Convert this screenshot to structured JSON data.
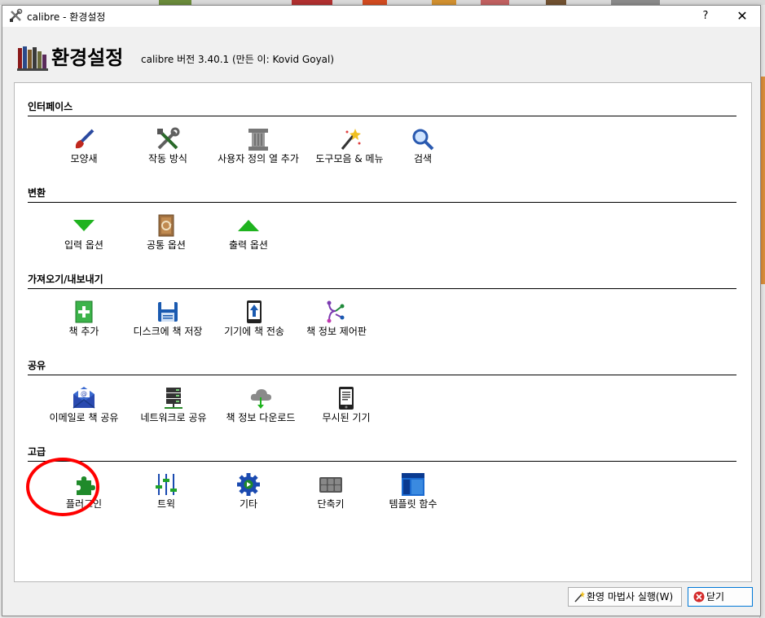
{
  "window": {
    "title": "calibre - 환경설정",
    "help_label": "?",
    "close_label": "✕"
  },
  "header": {
    "title": "환경설정",
    "version_info": "calibre 버전 3.40.1 (만든 이: Kovid Goyal)"
  },
  "sections": [
    {
      "title": "인터페이스",
      "items": [
        {
          "label": "모양새",
          "icon": "paintbrush-icon"
        },
        {
          "label": "작동 방식",
          "icon": "tools-icon"
        },
        {
          "label": "사용자 정의 열 추가",
          "icon": "column-icon"
        },
        {
          "label": "도구모음 & 메뉴",
          "icon": "magic-wand-icon"
        },
        {
          "label": "검색",
          "icon": "search-icon"
        }
      ]
    },
    {
      "title": "변환",
      "items": [
        {
          "label": "입력 옵션",
          "icon": "arrow-down-icon"
        },
        {
          "label": "공통 옵션",
          "icon": "convert-book-icon"
        },
        {
          "label": "출력 옵션",
          "icon": "arrow-up-icon"
        }
      ]
    },
    {
      "title": "가져오기/내보내기",
      "items": [
        {
          "label": "책 추가",
          "icon": "add-book-icon"
        },
        {
          "label": "디스크에 책 저장",
          "icon": "save-disk-icon"
        },
        {
          "label": "기기에 책 전송",
          "icon": "send-device-icon"
        },
        {
          "label": "책 정보 제어판",
          "icon": "metadata-plugboard-icon"
        }
      ]
    },
    {
      "title": "공유",
      "items": [
        {
          "label": "이메일로 책 공유",
          "icon": "email-icon"
        },
        {
          "label": "네트워크로 공유",
          "icon": "server-icon"
        },
        {
          "label": "책 정보 다운로드",
          "icon": "cloud-download-icon"
        },
        {
          "label": "무시된 기기",
          "icon": "ereader-icon"
        }
      ]
    },
    {
      "title": "고급",
      "items": [
        {
          "label": "플러그인",
          "icon": "plugin-icon"
        },
        {
          "label": "트윅",
          "icon": "tweaks-icon"
        },
        {
          "label": "기타",
          "icon": "gear-icon"
        },
        {
          "label": "단축키",
          "icon": "keyboard-icon"
        },
        {
          "label": "템플릿 함수",
          "icon": "template-icon"
        }
      ]
    }
  ],
  "buttons": {
    "wizard_label": "환영 마법사 실행(W)",
    "close_label": "닫기"
  },
  "colors": {
    "highlight_circle": "#ff0000",
    "focus_border": "#0078d7"
  }
}
